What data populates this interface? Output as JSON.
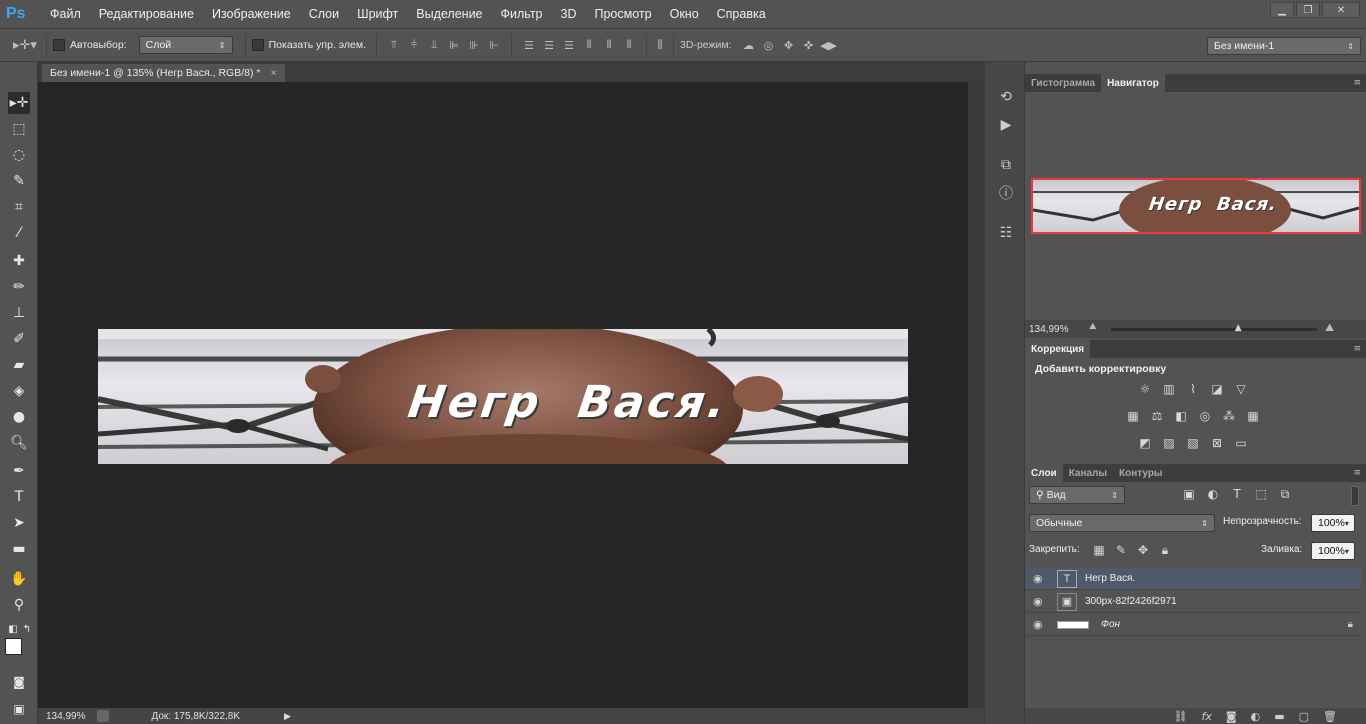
{
  "app": {
    "logo": "Ps"
  },
  "menu": [
    "Файл",
    "Редактирование",
    "Изображение",
    "Слои",
    "Шрифт",
    "Выделение",
    "Фильтр",
    "3D",
    "Просмотр",
    "Окно",
    "Справка"
  ],
  "window_controls": {
    "minimize": "▁",
    "restore": "❐",
    "close": "✕"
  },
  "options": {
    "autoselect_label": "Автовыбор:",
    "autoselect_value": "Слой",
    "show_controls_label": "Показать упр. элем.",
    "mode3d_label": "3D-режим:",
    "workspace_value": "Без имени-1"
  },
  "document": {
    "tab_title": "Без имени-1 @ 135% (Негр Вася., RGB/8) *",
    "tab_close": "×",
    "banner_text": "Негр  Вася.",
    "status_zoom": "134,99%",
    "status_doc": "Док: 175,8K/322,8K"
  },
  "navigator": {
    "tab_histogram": "Гистограмма",
    "tab_navigator": "Навигатор",
    "zoom": "134,99%",
    "zoom_fraction": 0.62
  },
  "adjustments": {
    "tab": "Коррекция",
    "heading": "Добавить корректировку"
  },
  "layers_panel": {
    "tabs": [
      "Слои",
      "Каналы",
      "Контуры"
    ],
    "filter_value": "Вид",
    "blend_mode": "Обычные",
    "opacity_label": "Непрозрачность:",
    "opacity_value": "100%",
    "lock_label": "Закрепить:",
    "fill_label": "Заливка:",
    "fill_value": "100%",
    "layers": [
      {
        "name": "Негр Вася.",
        "type": "text",
        "selected": true
      },
      {
        "name": "300px-82f2426f2971",
        "type": "smart",
        "selected": false
      },
      {
        "name": "Фон",
        "type": "background",
        "selected": false
      }
    ]
  },
  "colors": {
    "accent": "#3aa8f5",
    "nav_frame": "#e83a3a",
    "selected_layer": "#4e5a6a"
  }
}
